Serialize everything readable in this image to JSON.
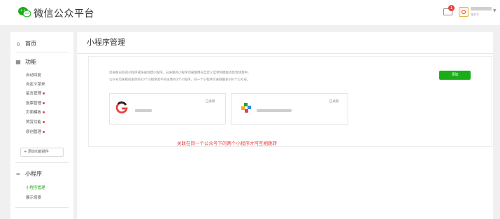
{
  "header": {
    "brand": "微信公众平台",
    "mail_badge": "1",
    "account_sub": "服务号"
  },
  "sidebar": {
    "home": "首页",
    "functions_title": "功能",
    "function_items": [
      {
        "label": "自动回复",
        "dot": false
      },
      {
        "label": "自定义菜单",
        "dot": false
      },
      {
        "label": "留言管理",
        "dot": true
      },
      {
        "label": "投票管理",
        "dot": true
      },
      {
        "label": "页面模板",
        "dot": true
      },
      {
        "label": "赞赏功能",
        "dot": true
      },
      {
        "label": "原创管理",
        "dot": true
      }
    ],
    "add_plugin": "+ 添加功能插件",
    "miniprogram_title": "小程序",
    "miniprogram_items": [
      {
        "label": "小程序管理",
        "active": true
      },
      {
        "label": "展示场景",
        "active": false
      }
    ]
  },
  "main": {
    "title": "小程序管理",
    "desc_line1": "可关联已有的小程序或快速创建小程序。已关联的小程序可被使用在自定义菜单和模板消息等场景中。",
    "desc_line2": "公众号可关联同主体的10个小程序及不同主体的3个小程序。同一个小程序可关联最多500个公众号。",
    "add_button": "添加",
    "cards": [
      {
        "status": "已关联",
        "icon": "g-logo-icon"
      },
      {
        "status": "已关联",
        "icon": "colorful-logo-icon"
      }
    ],
    "note": "关联在同一个公众号下的两个小程序才可互相跳转"
  },
  "colors": {
    "accent": "#1aad19",
    "note": "#e64340",
    "badge": "#e64340"
  }
}
